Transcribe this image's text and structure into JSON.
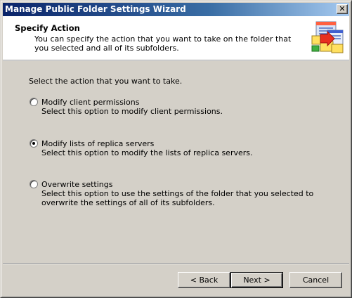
{
  "window": {
    "title": "Manage Public Folder Settings Wizard",
    "close_label": "✕"
  },
  "header": {
    "title": "Specify Action",
    "description": "You can specify the action that you want to take on the folder that you selected and all of its subfolders.",
    "graphic_icon": "wizard-folders-icon"
  },
  "main": {
    "prompt": "Select the action that you want to take.",
    "options": [
      {
        "label": "Modify client permissions",
        "description": "Select this option to modify client permissions.",
        "selected": false
      },
      {
        "label": "Modify lists of replica servers",
        "description": "Select this option to modify the lists of replica servers.",
        "selected": true
      },
      {
        "label": "Overwrite settings",
        "description": "Select this option to use the settings of the folder that you selected to overwrite the settings of all of its subfolders.",
        "selected": false
      }
    ]
  },
  "footer": {
    "back_label": "< Back",
    "next_label": "Next >",
    "cancel_label": "Cancel"
  },
  "colors": {
    "titlebar_start": "#0a246a",
    "titlebar_end": "#a6caf0",
    "dialog_bg": "#d4d0c8"
  }
}
